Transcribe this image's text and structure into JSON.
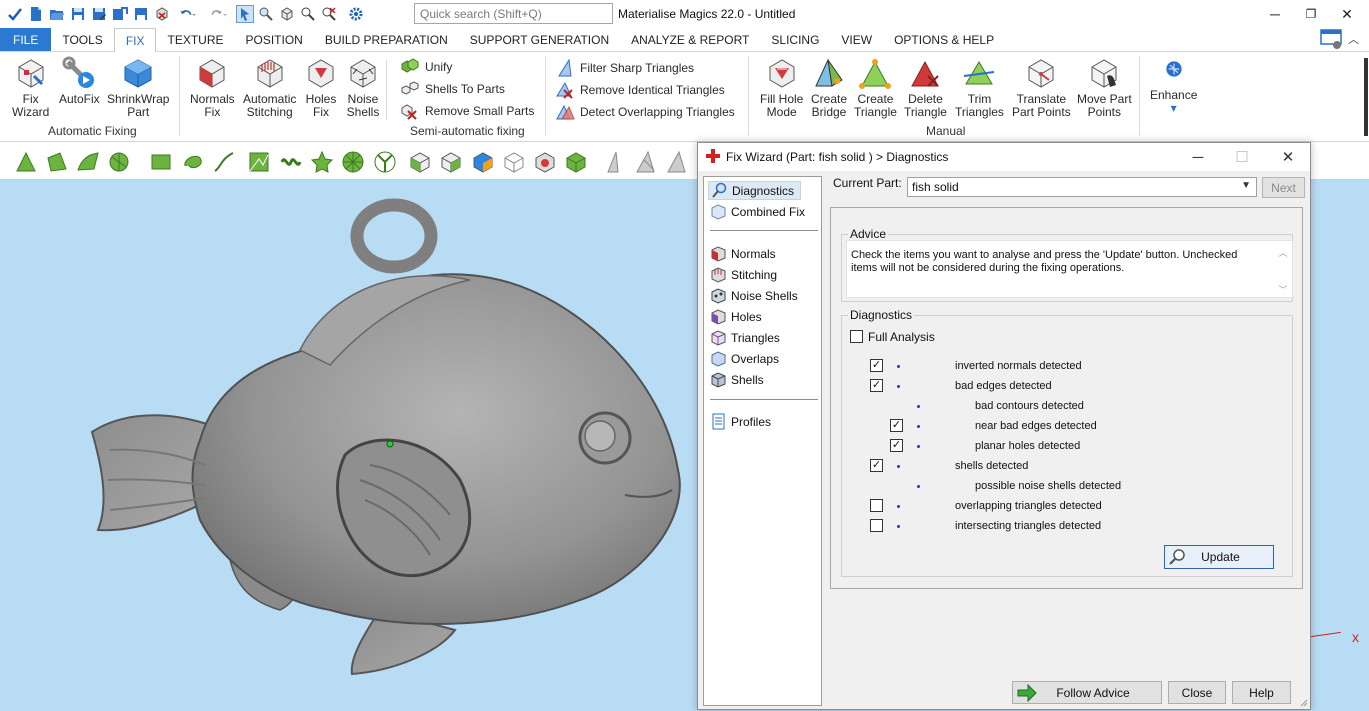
{
  "app": {
    "title": "Materialise Magics 22.0 - Untitled",
    "search_placeholder": "Quick search (Shift+Q)"
  },
  "window_controls": {
    "minimize": "─",
    "restore": "❐",
    "close": "✕"
  },
  "quick_access": [
    "app-logo-icon",
    "new-icon",
    "open-icon",
    "save-icon",
    "save-as-icon",
    "import-icon",
    "export-icon",
    "delete-icon",
    "undo-icon",
    "redo-icon",
    "select-icon",
    "zoom-select-icon",
    "view-icon",
    "zoom-icon",
    "zoom-reset-icon",
    "settings-icon"
  ],
  "menu": {
    "tabs": [
      "FILE",
      "TOOLS",
      "FIX",
      "TEXTURE",
      "POSITION",
      "BUILD PREPARATION",
      "SUPPORT GENERATION",
      "ANALYZE & REPORT",
      "SLICING",
      "VIEW",
      "OPTIONS & HELP"
    ],
    "active": "FIX"
  },
  "ribbon": {
    "automatic_fixing": {
      "label": "Automatic Fixing",
      "buttons": [
        {
          "line1": "Fix",
          "line2": "Wizard"
        },
        {
          "line1": "AutoFix",
          "line2": ""
        },
        {
          "line1": "ShrinkWrap",
          "line2": "Part"
        }
      ]
    },
    "semi_automatic": {
      "label": "Semi-automatic fixing",
      "buttons": [
        {
          "line1": "Normals",
          "line2": "Fix"
        },
        {
          "line1": "Automatic",
          "line2": "Stitching"
        },
        {
          "line1": "Holes",
          "line2": "Fix"
        },
        {
          "line1": "Noise",
          "line2": "Shells"
        }
      ],
      "small": [
        "Unify",
        "Shells To Parts",
        "Remove Small Parts"
      ]
    },
    "triangles": [
      "Filter Sharp Triangles",
      "Remove Identical Triangles",
      "Detect Overlapping Triangles"
    ],
    "manual": {
      "label": "Manual",
      "buttons": [
        {
          "line1": "Fill Hole",
          "line2": "Mode"
        },
        {
          "line1": "Create",
          "line2": "Bridge"
        },
        {
          "line1": "Create",
          "line2": "Triangle"
        },
        {
          "line1": "Delete",
          "line2": "Triangle"
        },
        {
          "line1": "Trim",
          "line2": "Triangles"
        },
        {
          "line1": "Translate",
          "line2": "Part Points"
        },
        {
          "line1": "Move Part",
          "line2": "Points"
        }
      ]
    },
    "enhance": {
      "label": "Enhance",
      "arrow": "▾"
    }
  },
  "dialog": {
    "title": "Fix Wizard (Part: fish solid ) > Diagnostics",
    "nav": {
      "top": [
        "Diagnostics",
        "Combined Fix"
      ],
      "middle": [
        "Normals",
        "Stitching",
        "Noise Shells",
        "Holes",
        "Triangles",
        "Overlaps",
        "Shells"
      ],
      "bottom": [
        "Profiles"
      ],
      "selected": "Diagnostics"
    },
    "current_part_label": "Current Part:",
    "current_part_value": "fish solid",
    "next_label": "Next",
    "advice_label": "Advice",
    "advice_line1": "Check the items you want to analyse and press the 'Update' button. Unchecked",
    "advice_line2": "items will not be considered during the fixing operations.",
    "diagnostics_label": "Diagnostics",
    "full_analysis_label": "Full Analysis",
    "full_analysis_checked": false,
    "items": [
      {
        "label": "inverted normals detected",
        "checked": true,
        "level": 0,
        "has_checkbox": true
      },
      {
        "label": "bad edges detected",
        "checked": true,
        "level": 0,
        "has_checkbox": true
      },
      {
        "label": "bad contours detected",
        "checked": false,
        "level": 1,
        "has_checkbox": false
      },
      {
        "label": "near bad edges detected",
        "checked": true,
        "level": 1,
        "has_checkbox": true
      },
      {
        "label": "planar holes detected",
        "checked": true,
        "level": 1,
        "has_checkbox": true
      },
      {
        "label": "shells detected",
        "checked": true,
        "level": 0,
        "has_checkbox": true
      },
      {
        "label": "possible noise shells detected",
        "checked": false,
        "level": 1,
        "has_checkbox": false
      },
      {
        "label": "overlapping triangles detected",
        "checked": false,
        "level": 0,
        "has_checkbox": true
      },
      {
        "label": "intersecting triangles detected",
        "checked": false,
        "level": 0,
        "has_checkbox": true
      }
    ],
    "update_label": "Update",
    "follow_advice_label": "Follow Advice",
    "close_label": "Close",
    "help_label": "Help"
  },
  "viewport": {
    "background": "#b9dcf5",
    "axis_marker": "x"
  },
  "colors": {
    "accent": "#2b79d0",
    "file_tab": "#2b79d0",
    "update_border": "#2d64b3"
  }
}
